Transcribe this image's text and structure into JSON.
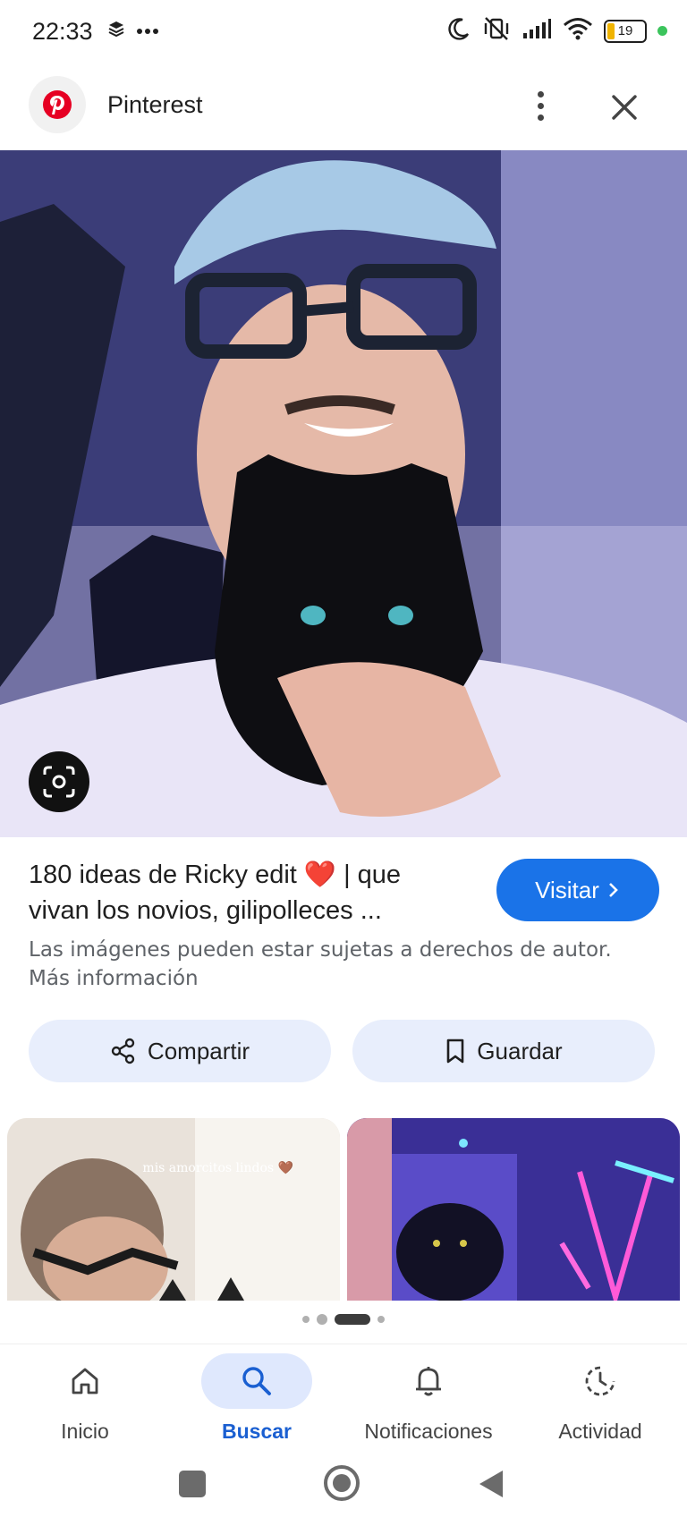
{
  "status": {
    "time": "22:33",
    "battery": "19"
  },
  "app": {
    "title": "Pinterest"
  },
  "result": {
    "title": "180 ideas de Ricky edit ❤️ | que vivan los novios, gilipolleces ...",
    "visit_label": "Visitar",
    "disclaimer": "Las imágenes pueden estar sujetas a derechos de autor. Más información"
  },
  "actions": {
    "share_label": "Compartir",
    "save_label": "Guardar"
  },
  "related": {
    "thumb1_caption": "mis amorcitos lindos 🤎"
  },
  "nav": {
    "items": [
      {
        "label": "Inicio",
        "icon": "home-icon"
      },
      {
        "label": "Buscar",
        "icon": "search-icon",
        "active": true
      },
      {
        "label": "Notificaciones",
        "icon": "bell-icon"
      },
      {
        "label": "Actividad",
        "icon": "activity-icon"
      }
    ]
  },
  "colors": {
    "accent": "#1a73e8",
    "chip_bg": "#e8eefc",
    "active_nav_bg": "#dfe8fd"
  }
}
